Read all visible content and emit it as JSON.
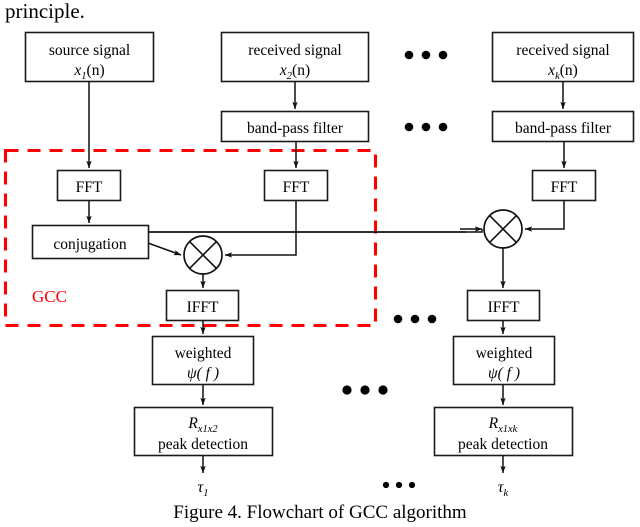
{
  "page": {
    "body_text_fragment": "principle.",
    "caption": "Figure 4. Flowchart of GCC algorithm"
  },
  "diagram": {
    "title": "Flowchart of GCC algorithm",
    "group_label": "GCC",
    "group_label_color": "#ff0000",
    "ellipsis": "• • •",
    "columns": [
      {
        "id": "col-source",
        "signal_box": {
          "line1": "source signal",
          "line2_base": "x",
          "line2_sub": "1",
          "line2_tail": "(n)"
        },
        "has_bandpass": false,
        "fft_label": "FFT",
        "conjugation_label": "conjugation"
      },
      {
        "id": "col-x2",
        "signal_box": {
          "line1": "received signal",
          "line2_base": "x",
          "line2_sub": "2",
          "line2_tail": "(n)"
        },
        "has_bandpass": true,
        "bandpass_label": "band-pass filter",
        "fft_label": "FFT",
        "ifft_label": "IFFT",
        "weighted_line1": "weighted",
        "weighted_line2": "ψ( f )",
        "peak_line1_base": "R",
        "peak_line1_sub": "x1x2",
        "peak_line2": "peak detection",
        "output_base": "τ",
        "output_sub": "1"
      },
      {
        "id": "col-xk",
        "signal_box": {
          "line1": "received signal",
          "line2_base": "x",
          "line2_sub": "k",
          "line2_tail": "(n)"
        },
        "has_bandpass": true,
        "bandpass_label": "band-pass filter",
        "fft_label": "FFT",
        "ifft_label": "IFFT",
        "weighted_line1": "weighted",
        "weighted_line2": "ψ( f )",
        "peak_line1_base": "R",
        "peak_line1_sub": "x1xk",
        "peak_line2": "peak detection",
        "output_base": "τ",
        "output_sub": "k"
      }
    ],
    "operators": {
      "multiply_symbol": "⊗",
      "multiply_name": "cross-multiply"
    },
    "colors": {
      "stroke": "#111111",
      "box_fill": "#ffffff",
      "accent": "#ff0000",
      "background": "#ffffff"
    }
  }
}
